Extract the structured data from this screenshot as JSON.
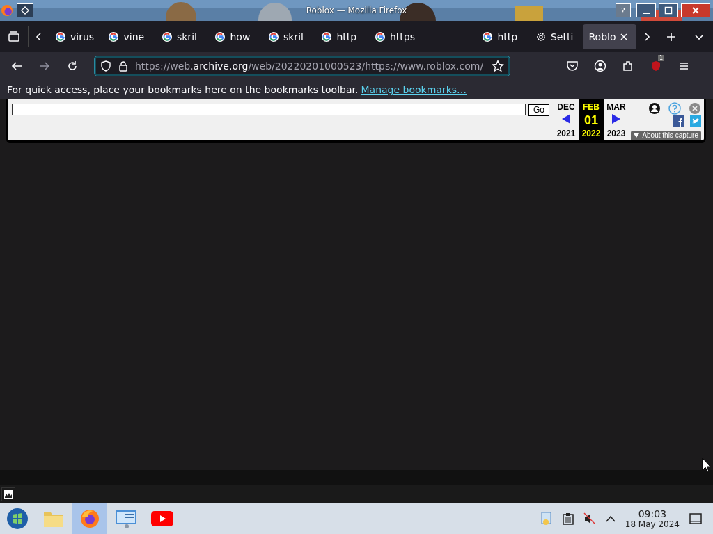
{
  "window": {
    "title": "Roblox — Mozilla Firefox",
    "help_button": "?"
  },
  "tabs": [
    {
      "label": "virus",
      "kind": "google",
      "selected": false
    },
    {
      "label": "vine",
      "kind": "google",
      "selected": false
    },
    {
      "label": "skril",
      "kind": "google",
      "selected": false
    },
    {
      "label": "how",
      "kind": "google",
      "selected": false
    },
    {
      "label": "skril",
      "kind": "google",
      "selected": false
    },
    {
      "label": "http",
      "kind": "google",
      "selected": false
    },
    {
      "label": "https",
      "kind": "google",
      "selected": false
    },
    {
      "label": "http",
      "kind": "google",
      "selected": false
    },
    {
      "label": "Setti",
      "kind": "settings",
      "selected": false
    },
    {
      "label": "Roblo",
      "kind": "plain",
      "selected": true
    }
  ],
  "address_bar": {
    "prefix": "https://web.",
    "domain": "archive.org",
    "path": "/web/20220201000523/https://www.roblox.com/"
  },
  "extension_badge": "1",
  "bookmarks_bar": {
    "message": "For quick access, place your bookmarks here on the bookmarks toolbar.",
    "link": "Manage bookmarks…"
  },
  "wayback": {
    "button": "Go",
    "months": [
      {
        "label": "DEC",
        "selected": false
      },
      {
        "label": "FEB",
        "selected": true
      },
      {
        "label": "MAR",
        "selected": false
      }
    ],
    "day": "01",
    "years": [
      {
        "label": "2021",
        "selected": false
      },
      {
        "label": "2022",
        "selected": true
      },
      {
        "label": "2023",
        "selected": false
      }
    ],
    "about": "About this capture"
  },
  "taskbar": {
    "apps": [
      {
        "kind": "start",
        "active": false
      },
      {
        "kind": "folder",
        "active": false
      },
      {
        "kind": "firefox",
        "active": true
      },
      {
        "kind": "monitor",
        "active": false
      },
      {
        "kind": "youtube",
        "active": false
      }
    ],
    "time": "09:03",
    "date": "18 May 2024"
  }
}
